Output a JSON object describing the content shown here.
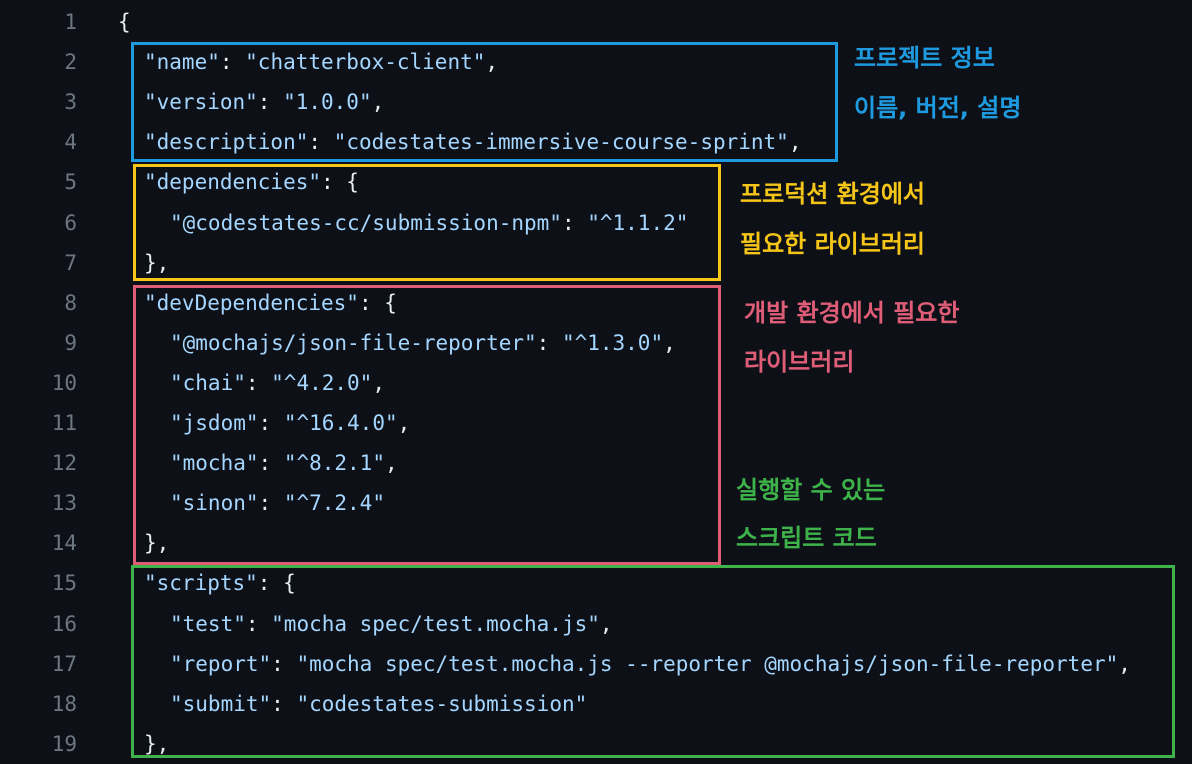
{
  "editor": {
    "lines": [
      {
        "n": "1",
        "indent": 0,
        "segs": [
          {
            "t": "{",
            "c": "punc"
          }
        ]
      },
      {
        "n": "2",
        "indent": 1,
        "segs": [
          {
            "t": "\"name\"",
            "c": "key"
          },
          {
            "t": ": ",
            "c": "punc"
          },
          {
            "t": "\"chatterbox-client\"",
            "c": "str"
          },
          {
            "t": ",",
            "c": "punc"
          }
        ]
      },
      {
        "n": "3",
        "indent": 1,
        "segs": [
          {
            "t": "\"version\"",
            "c": "key"
          },
          {
            "t": ": ",
            "c": "punc"
          },
          {
            "t": "\"1.0.0\"",
            "c": "str"
          },
          {
            "t": ",",
            "c": "punc"
          }
        ]
      },
      {
        "n": "4",
        "indent": 1,
        "segs": [
          {
            "t": "\"description\"",
            "c": "key"
          },
          {
            "t": ": ",
            "c": "punc"
          },
          {
            "t": "\"codestates-immersive-course-sprint\"",
            "c": "str"
          },
          {
            "t": ",",
            "c": "punc"
          }
        ]
      },
      {
        "n": "5",
        "indent": 1,
        "segs": [
          {
            "t": "\"dependencies\"",
            "c": "key"
          },
          {
            "t": ": {",
            "c": "punc"
          }
        ]
      },
      {
        "n": "6",
        "indent": 2,
        "segs": [
          {
            "t": "\"@codestates-cc/submission-npm\"",
            "c": "key"
          },
          {
            "t": ": ",
            "c": "punc"
          },
          {
            "t": "\"^1.1.2\"",
            "c": "str"
          }
        ]
      },
      {
        "n": "7",
        "indent": 1,
        "segs": [
          {
            "t": "},",
            "c": "punc"
          }
        ]
      },
      {
        "n": "8",
        "indent": 1,
        "segs": [
          {
            "t": "\"devDependencies\"",
            "c": "key"
          },
          {
            "t": ": {",
            "c": "punc"
          }
        ]
      },
      {
        "n": "9",
        "indent": 2,
        "segs": [
          {
            "t": "\"@mochajs/json-file-reporter\"",
            "c": "key"
          },
          {
            "t": ": ",
            "c": "punc"
          },
          {
            "t": "\"^1.3.0\"",
            "c": "str"
          },
          {
            "t": ",",
            "c": "punc"
          }
        ]
      },
      {
        "n": "10",
        "indent": 2,
        "segs": [
          {
            "t": "\"chai\"",
            "c": "key"
          },
          {
            "t": ": ",
            "c": "punc"
          },
          {
            "t": "\"^4.2.0\"",
            "c": "str"
          },
          {
            "t": ",",
            "c": "punc"
          }
        ]
      },
      {
        "n": "11",
        "indent": 2,
        "segs": [
          {
            "t": "\"jsdom\"",
            "c": "key"
          },
          {
            "t": ": ",
            "c": "punc"
          },
          {
            "t": "\"^16.4.0\"",
            "c": "str"
          },
          {
            "t": ",",
            "c": "punc"
          }
        ]
      },
      {
        "n": "12",
        "indent": 2,
        "segs": [
          {
            "t": "\"mocha\"",
            "c": "key"
          },
          {
            "t": ": ",
            "c": "punc"
          },
          {
            "t": "\"^8.2.1\"",
            "c": "str"
          },
          {
            "t": ",",
            "c": "punc"
          }
        ]
      },
      {
        "n": "13",
        "indent": 2,
        "segs": [
          {
            "t": "\"sinon\"",
            "c": "key"
          },
          {
            "t": ": ",
            "c": "punc"
          },
          {
            "t": "\"^7.2.4\"",
            "c": "str"
          }
        ]
      },
      {
        "n": "14",
        "indent": 1,
        "segs": [
          {
            "t": "},",
            "c": "punc"
          }
        ]
      },
      {
        "n": "15",
        "indent": 1,
        "segs": [
          {
            "t": "\"scripts\"",
            "c": "key"
          },
          {
            "t": ": {",
            "c": "punc"
          }
        ]
      },
      {
        "n": "16",
        "indent": 2,
        "segs": [
          {
            "t": "\"test\"",
            "c": "key"
          },
          {
            "t": ": ",
            "c": "punc"
          },
          {
            "t": "\"mocha spec/test.mocha.js\"",
            "c": "str"
          },
          {
            "t": ",",
            "c": "punc"
          }
        ]
      },
      {
        "n": "17",
        "indent": 2,
        "segs": [
          {
            "t": "\"report\"",
            "c": "key"
          },
          {
            "t": ": ",
            "c": "punc"
          },
          {
            "t": "\"mocha spec/test.mocha.js --reporter @mochajs/json-file-reporter\"",
            "c": "str"
          },
          {
            "t": ",",
            "c": "punc"
          }
        ]
      },
      {
        "n": "18",
        "indent": 2,
        "segs": [
          {
            "t": "\"submit\"",
            "c": "key"
          },
          {
            "t": ": ",
            "c": "punc"
          },
          {
            "t": "\"codestates-submission\"",
            "c": "str"
          }
        ]
      },
      {
        "n": "19",
        "indent": 1,
        "segs": [
          {
            "t": "},",
            "c": "punc"
          }
        ]
      }
    ]
  },
  "annotations": {
    "project_info": {
      "color": "#1e9be0",
      "line1": "프로젝트 정보",
      "line2": "이름, 버전, 설명"
    },
    "dependencies": {
      "color": "#f5c518",
      "line1": "프로덕션 환경에서",
      "line2": "필요한 라이브러리"
    },
    "dev_dependencies": {
      "color": "#e05d78",
      "line1": "개발 환경에서 필요한",
      "line2": "라이브러리"
    },
    "scripts": {
      "color": "#3db34a",
      "line1": "실행할 수 있는",
      "line2": "스크립트 코드"
    }
  },
  "theme": {
    "background": "#0d1117",
    "line_number": "#6e7681",
    "code_text": "#e6edf3",
    "string_color": "#a5d6ff"
  }
}
